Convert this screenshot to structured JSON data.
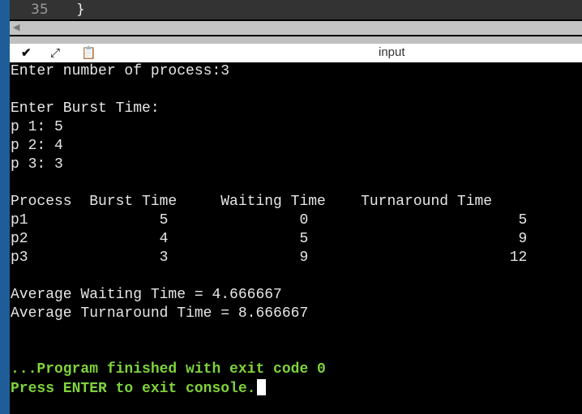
{
  "editor": {
    "line_number": "35",
    "code": "}"
  },
  "toolbar": {
    "title": "input",
    "icons": [
      "chevron-down-icon",
      "expand-icon",
      "paste-icon"
    ]
  },
  "console": {
    "lines": [
      "Enter number of process:3",
      "",
      "Enter Burst Time:",
      "p 1: 5",
      "p 2: 4",
      "p 3: 3",
      "",
      "Process  Burst Time     Waiting Time    Turnaround Time",
      "p1               5               0                        5",
      "p2               4               5                        9",
      "p3               3               9                       12",
      "",
      "Average Waiting Time = 4.666667",
      "Average Turnaround Time = 8.666667",
      "",
      "",
      "...Program finished with exit code 0",
      "Press ENTER to exit console."
    ]
  },
  "colors": {
    "accent_green": "#7ed33b",
    "side_blue": "#1f5d99"
  }
}
